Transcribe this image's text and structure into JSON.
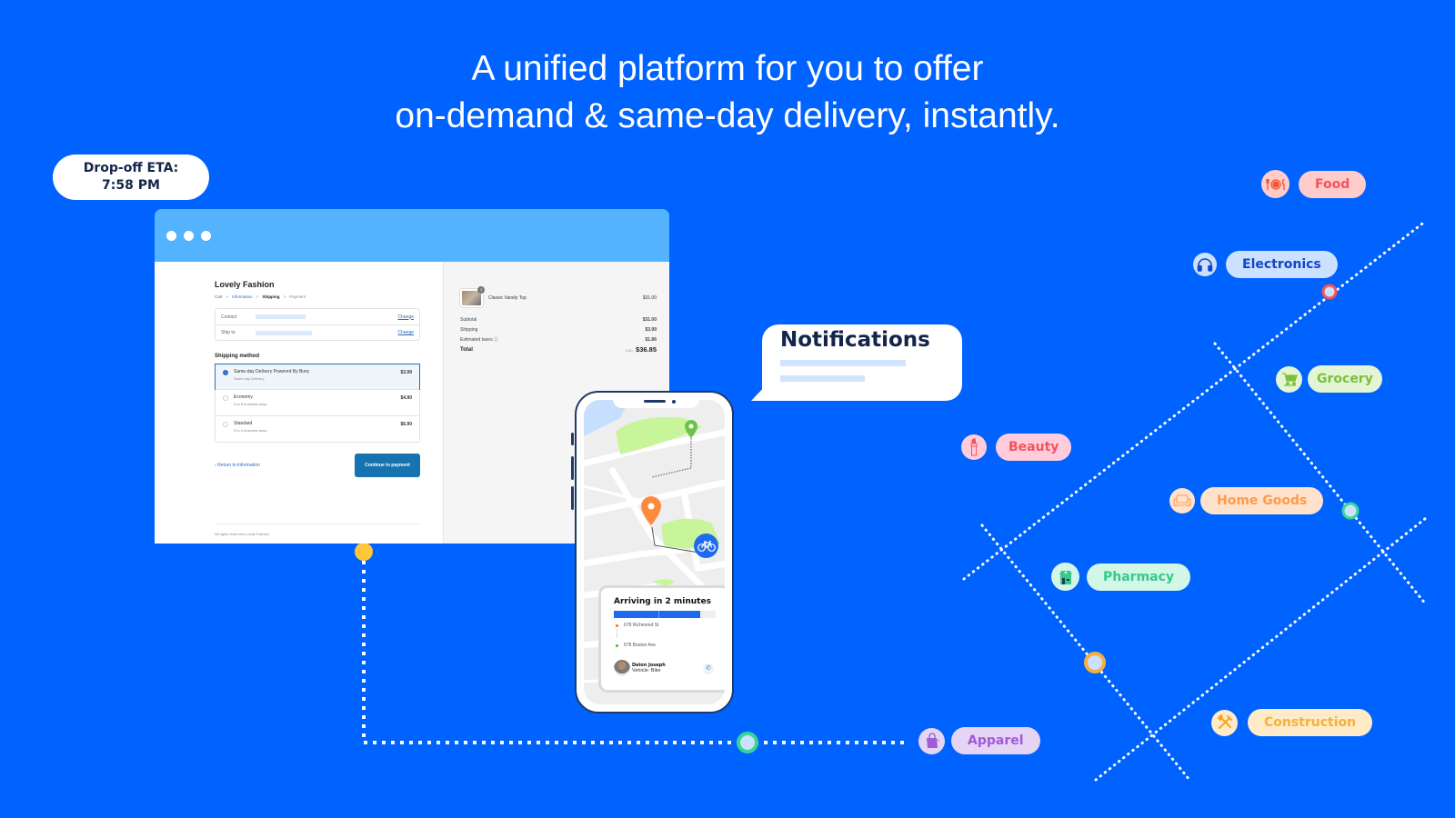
{
  "headline": {
    "line1": "A unified platform for you to offer",
    "line2": "on-demand & same-day delivery, instantly."
  },
  "eta": {
    "label": "Drop-off ETA:",
    "time": "7:58 PM"
  },
  "checkout": {
    "store_name": "Lovely Fashion",
    "breadcrumbs": [
      {
        "label": "Cart",
        "state": "link"
      },
      {
        "label": "Information",
        "state": "link"
      },
      {
        "label": "Shipping",
        "state": "current"
      },
      {
        "label": "Payment",
        "state": "pending"
      }
    ],
    "breadcrumb_separator": ">",
    "contact_label": "Contact",
    "ship_to_label": "Ship to",
    "change_label": "Change",
    "shipping_method_title": "Shipping method",
    "shipping_options": [
      {
        "name": "Same-day Delivery Powered By Burq",
        "sub": "Same day Delivery",
        "price": "$3.99",
        "selected": true
      },
      {
        "name": "Economy",
        "sub": "5 to 8 business days",
        "price": "$4.90",
        "selected": false
      },
      {
        "name": "Standard",
        "sub": "3 to 4 business days",
        "price": "$6.90",
        "selected": false
      }
    ],
    "return_link": "Return to information",
    "continue_button": "Continue to payment",
    "footer": "All rights reserved Lovely Fashion",
    "order": {
      "item_name": "Classic Varsity Top",
      "item_qty": "1",
      "item_price": "$31.00",
      "subtotal_label": "Subtotal",
      "subtotal": "$31.00",
      "shipping_label": "Shipping",
      "shipping": "$3.99",
      "taxes_label": "Estimated taxes",
      "taxes": "$1.86",
      "total_label": "Total",
      "currency": "USD",
      "total": "$36.85"
    }
  },
  "phone": {
    "arrival_title": "Arriving in 2 minutes",
    "progress_fraction": 0.85,
    "pickup_address": "678 Richmond St",
    "dropoff_address": "678 Boston Ave",
    "driver_name": "Deion Joseph",
    "driver_vehicle": "Vehicle: Bike",
    "icons": {
      "pickup_pin": "map-pin-orange",
      "dropoff_pin": "map-pin-green",
      "courier": "bicycle-icon",
      "call": "phone-icon"
    }
  },
  "notification": {
    "title": "Notifications"
  },
  "categories": [
    {
      "label": "Food",
      "icon": "plate-cutlery-icon",
      "text_color": "#F2545B",
      "pill_bg": "#FFCBCB",
      "icon_bg": "#FFCBCB",
      "icon_color": "#F2542D"
    },
    {
      "label": "Electronics",
      "icon": "headphones-icon",
      "text_color": "#1246C9",
      "pill_bg": "#CCE0FF",
      "icon_bg": "#CCE0FF",
      "icon_color": "#1246C9"
    },
    {
      "label": "Grocery",
      "icon": "shopping-cart-icon",
      "text_color": "#7CBF3A",
      "pill_bg": "#E3F5D5",
      "icon_bg": "#E3F5D5",
      "icon_color": "#7CBF3A"
    },
    {
      "label": "Beauty",
      "icon": "lipstick-icon",
      "text_color": "#F2545B",
      "pill_bg": "#FFCCDD",
      "icon_bg": "#FFCCDD",
      "icon_color": "#F2545B"
    },
    {
      "label": "Home Goods",
      "icon": "sofa-icon",
      "text_color": "#FF9A4A",
      "pill_bg": "#FFE2CC",
      "icon_bg": "#FFE2CC",
      "icon_color": "#FF9A4A"
    },
    {
      "label": "Pharmacy",
      "icon": "pharmacy-store-icon",
      "text_color": "#36C98A",
      "pill_bg": "#D3F7E6",
      "icon_bg": "#D3F7E6",
      "icon_color": "#36C98A"
    },
    {
      "label": "Construction",
      "icon": "tools-icon",
      "text_color": "#F5B041",
      "pill_bg": "#FFEBC7",
      "icon_bg": "#FFEBC7",
      "icon_color": "#F5A623"
    },
    {
      "label": "Apparel",
      "icon": "shopping-bag-icon",
      "text_color": "#A25BD8",
      "pill_bg": "#E6D4F5",
      "icon_bg": "#E6D4F5",
      "icon_color": "#A25BD8"
    }
  ],
  "colors": {
    "background": "#0062FF",
    "browser_bar": "#53B3FF",
    "primary_button": "#1773B0",
    "navy_text": "#13254A",
    "node_yellow": "#FFC63A",
    "node_green": "#36D695",
    "node_red": "#F2545B",
    "node_orange": "#F5B041"
  }
}
